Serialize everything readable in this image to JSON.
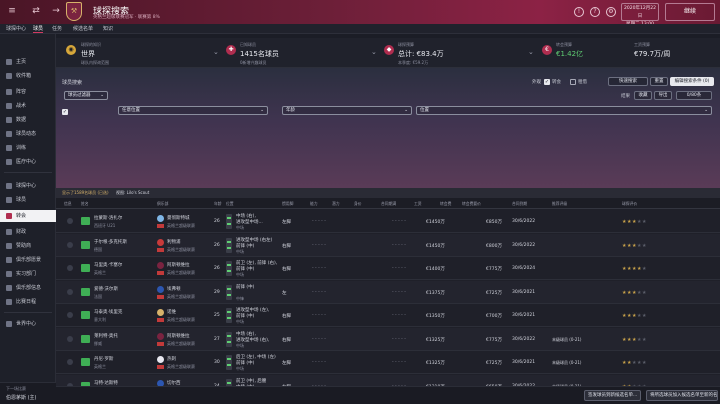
{
  "topbar": {
    "title": "球探搜索",
    "subtitle": "英格兰超级联赛冠军 · 联赛第 8%",
    "date_line1": "2020年12月22日",
    "date_line2": "星期二 13:00",
    "continue_label": "继续"
  },
  "subnav": {
    "items": [
      "球探中心",
      "球员",
      "任务",
      "候选名单",
      "知识"
    ]
  },
  "sidebar": {
    "items": [
      "主页",
      "收件箱",
      "阵容",
      "战术",
      "数据",
      "球员动态",
      "训练",
      "医疗中心",
      "球探中心",
      "球员",
      "转会",
      "财政",
      "赞助商",
      "俱乐部愿景",
      "实习部门",
      "俱乐部信息",
      "比赛日程",
      "世界中心"
    ],
    "active_index": 9,
    "profile_top": "下一场比赛",
    "profile_bottom": "伯恩茅斯 (主)"
  },
  "stats": {
    "s1_label": "球探的知识",
    "s1_value": "世界",
    "s1_sub": "球队内探询范围",
    "s2_label": "已知球员",
    "s2_value": "1415名球员",
    "s2_sub": "0新增兴趣球员",
    "s3_label": "球探预算",
    "s3_value": "总计: €83.4万",
    "s3_sub": "本季度: €59.2万",
    "s4_label": "转会预算",
    "s4_value": "€1.42亿",
    "s5_label": "工资预算",
    "s5_value": "€79.7万/周"
  },
  "controls": {
    "section_label": "球员搜索",
    "chk_label1": "转会",
    "chk_label2": "租借",
    "btn_scout": "快速搜索",
    "btn_reset": "重置",
    "btn_saved": "编辑搜索条件 (0)",
    "filter_select": "球员过滤器",
    "count_label": "结果",
    "btn_fav": "收藏",
    "btn_shortlist": "导出",
    "btn_pages": "0/80条",
    "f1": "任意位置",
    "f2": "年龄",
    "f3": "位置"
  },
  "table": {
    "tab_left": "显示了1589名球员 (已选)",
    "tab_right": "视图: Lilo's Scout",
    "headers": [
      "信息",
      "姓名",
      "俱乐部",
      "年龄",
      "位置",
      "惯用脚",
      "能力",
      "潜力",
      "身价",
      "合同期满",
      "工资",
      "转会费",
      "转会费要价",
      "合同到期",
      "推荐评级",
      "球探评价"
    ],
    "rows": [
      {
        "name": "拉蒙斯·洛扎尔",
        "club": "曼彻斯特城",
        "club_sub": "英格兰超级联赛",
        "age": "26",
        "pos1": "中场 (右),",
        "pos2": "进攻型中场...",
        "pos3": "中场",
        "foot": "左脚",
        "dash": "- - - - -",
        "fee": "€1450万",
        "wage": "€850万",
        "expiry": "30/6/2022",
        "rec": "",
        "stars": 3,
        "club_color": "#7fb6e6",
        "sub": "西班牙 U21"
      },
      {
        "name": "于尔根·多克托斯",
        "club": "利物浦",
        "club_sub": "英格兰超级联赛",
        "age": "26",
        "pos1": "进攻型中场 (右左)",
        "pos2": "前锋 (中)",
        "pos3": "中场",
        "foot": "右脚",
        "dash": "- - - - -",
        "fee": "€1450万",
        "wage": "€800万",
        "expiry": "30/6/2022",
        "rec": "",
        "stars": 3,
        "club_color": "#c83a3a",
        "sub": "德国"
      },
      {
        "name": "马里奥·卡塞尔",
        "club": "阿斯顿维拉",
        "club_sub": "英格兰超级联赛",
        "age": "26",
        "pos1": "前卫 (左), 前锋 (右),",
        "pos2": "前锋 (中)",
        "pos3": "中场",
        "foot": "右脚",
        "dash": "- - - - -",
        "fee": "€1400万",
        "wage": "€775万",
        "expiry": "30/6/2024",
        "rec": "",
        "stars": 4,
        "club_color": "#7a2340",
        "sub": "英格兰"
      },
      {
        "name": "爱德·沃尔斯",
        "club": "埃弗顿",
        "club_sub": "英格兰超级联赛",
        "age": "29",
        "pos1": "前锋 (中)",
        "pos2": "",
        "pos3": "中锋",
        "foot": "左",
        "dash": "- - - - -",
        "fee": "€1375万",
        "wage": "€725万",
        "expiry": "30/6/2021",
        "rec": "",
        "stars": 3,
        "club_color": "#2c56b0",
        "sub": "法国"
      },
      {
        "name": "马泰奥·埃里克",
        "club": "诺维",
        "club_sub": "英格兰超级联赛",
        "age": "25",
        "pos1": "进攻型中场 (左),",
        "pos2": "前锋 (中)",
        "pos3": "中场",
        "foot": "右脚",
        "dash": "- - - - -",
        "fee": "€1350万",
        "wage": "€700万",
        "expiry": "30/6/2021",
        "rec": "",
        "stars": 3,
        "club_color": "#d7b26a",
        "sub": "意大利"
      },
      {
        "name": "莱利特·奥托",
        "club": "阿斯顿维拉",
        "club_sub": "英格兰超级联赛",
        "age": "27",
        "pos1": "中场 (右),",
        "pos2": "进攻型中场 (右),",
        "pos3": "中场",
        "foot": "右脚",
        "dash": "- - - - -",
        "fee": "€1325万",
        "wage": "€775万",
        "expiry": "30/6/2022",
        "rec": "末级球员 (0-21)",
        "stars": 3,
        "club_color": "#7a2340",
        "sub": "挪威"
      },
      {
        "name": "丹尼·罗斯",
        "club": "热刺",
        "club_sub": "英格兰超级联赛",
        "age": "30",
        "pos1": "后卫 (左), 中场 (左)",
        "pos2": "前锋 (中)",
        "pos3": "中场",
        "foot": "左脚",
        "dash": "- - - - -",
        "fee": "€1325万",
        "wage": "€725万",
        "expiry": "30/6/2021",
        "rec": "末级球员 (0-21)",
        "stars": 2,
        "club_color": "#e8e8f0",
        "sub": "英格兰"
      },
      {
        "name": "马特·达斯特",
        "club": "切尔西",
        "club_sub": "英格兰超级联赛",
        "age": "24",
        "pos1": "前卫 (中), 后腰",
        "pos2": "中场 (中)",
        "pos3": "中场",
        "foot": "右脚",
        "dash": "- - - - -",
        "fee": "€1310万",
        "wage": "€650万",
        "expiry": "30/6/2022",
        "rec": "末级球员 (0-21)",
        "stars": 2,
        "club_color": "#2c56b0",
        "sub": "英格兰"
      }
    ]
  },
  "footer": {
    "btn1": "签发球员到新候选名单...",
    "btn2": "将所选球员加入候选名单至新的名单..."
  }
}
